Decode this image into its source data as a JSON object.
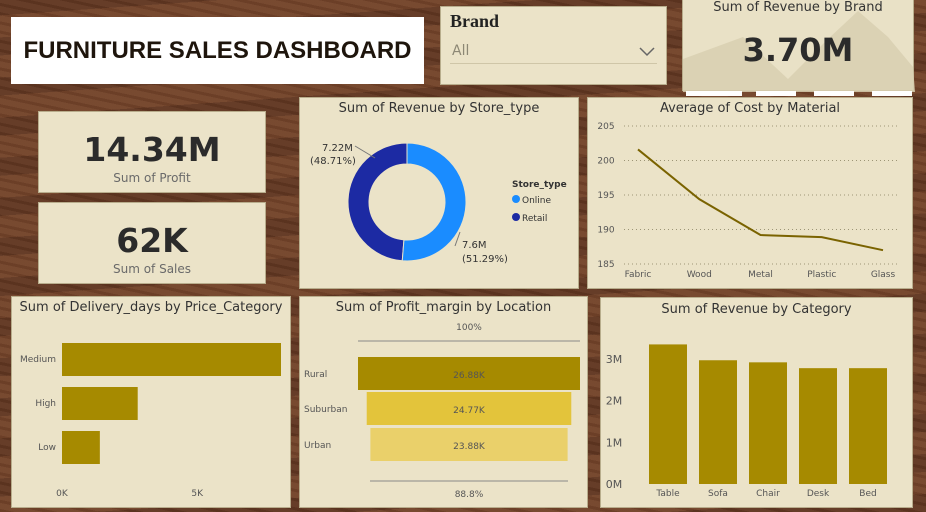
{
  "dashboard_title": "FURNITURE SALES DASHBOARD",
  "brand_filter": {
    "label": "Brand",
    "value": "All"
  },
  "kpis": {
    "revenue_by_brand": {
      "title": "Sum of Revenue by Brand",
      "value": "3.70M"
    },
    "profit": {
      "value": "14.34M",
      "label": "Sum of Profit"
    },
    "sales": {
      "value": "62K",
      "label": "Sum of Sales"
    }
  },
  "colors": {
    "olive": "#a68a00",
    "online": "#1a8cff",
    "retail": "#1c2aa3",
    "suburban": "#e3c43b",
    "urban": "#ead06a"
  },
  "chart_data": [
    {
      "type": "pie",
      "title": "Sum of Revenue by Store_type",
      "legend_title": "Store_type",
      "slices": [
        {
          "name": "Online",
          "value": 7.6,
          "label": "7.6M",
          "pct": "(51.29%)"
        },
        {
          "name": "Retail",
          "value": 7.22,
          "label": "7.22M",
          "pct": "(48.71%)"
        }
      ]
    },
    {
      "type": "line",
      "title": "Average of Cost by Material",
      "categories": [
        "Fabric",
        "Wood",
        "Metal",
        "Plastic",
        "Glass"
      ],
      "values": [
        201.6,
        194.4,
        189.2,
        188.9,
        187.0
      ],
      "ylim": [
        185,
        205
      ],
      "yticks": [
        185,
        190,
        195,
        200,
        205
      ],
      "grid": true
    },
    {
      "type": "bar",
      "title": "Sum of Delivery_days by Price_Category",
      "orientation": "horizontal",
      "categories": [
        "Medium",
        "High",
        "Low"
      ],
      "values": [
        8100,
        2800,
        1400
      ],
      "xlim": [
        0,
        8100
      ],
      "xticks": [
        {
          "value": 0,
          "label": "0K"
        },
        {
          "value": 5000,
          "label": "5K"
        }
      ]
    },
    {
      "type": "bar",
      "title": "Sum of Profit_margin by Location",
      "orientation": "horizontal",
      "top_label": "100%",
      "bottom_label": "88.8%",
      "categories": [
        "Rural",
        "Suburban",
        "Urban"
      ],
      "values": [
        26.88,
        24.77,
        23.88
      ],
      "value_labels": [
        "26.88K",
        "24.77K",
        "23.88K"
      ]
    },
    {
      "type": "bar",
      "title": "Sum of Revenue by Category",
      "categories": [
        "Table",
        "Sofa",
        "Chair",
        "Desk",
        "Bed"
      ],
      "values": [
        3.35,
        2.97,
        2.92,
        2.78,
        2.78
      ],
      "ylim": [
        0,
        3.6
      ],
      "yticks": [
        {
          "value": 0,
          "label": "0M"
        },
        {
          "value": 1,
          "label": "1M"
        },
        {
          "value": 2,
          "label": "2M"
        },
        {
          "value": 3,
          "label": "3M"
        }
      ]
    }
  ]
}
